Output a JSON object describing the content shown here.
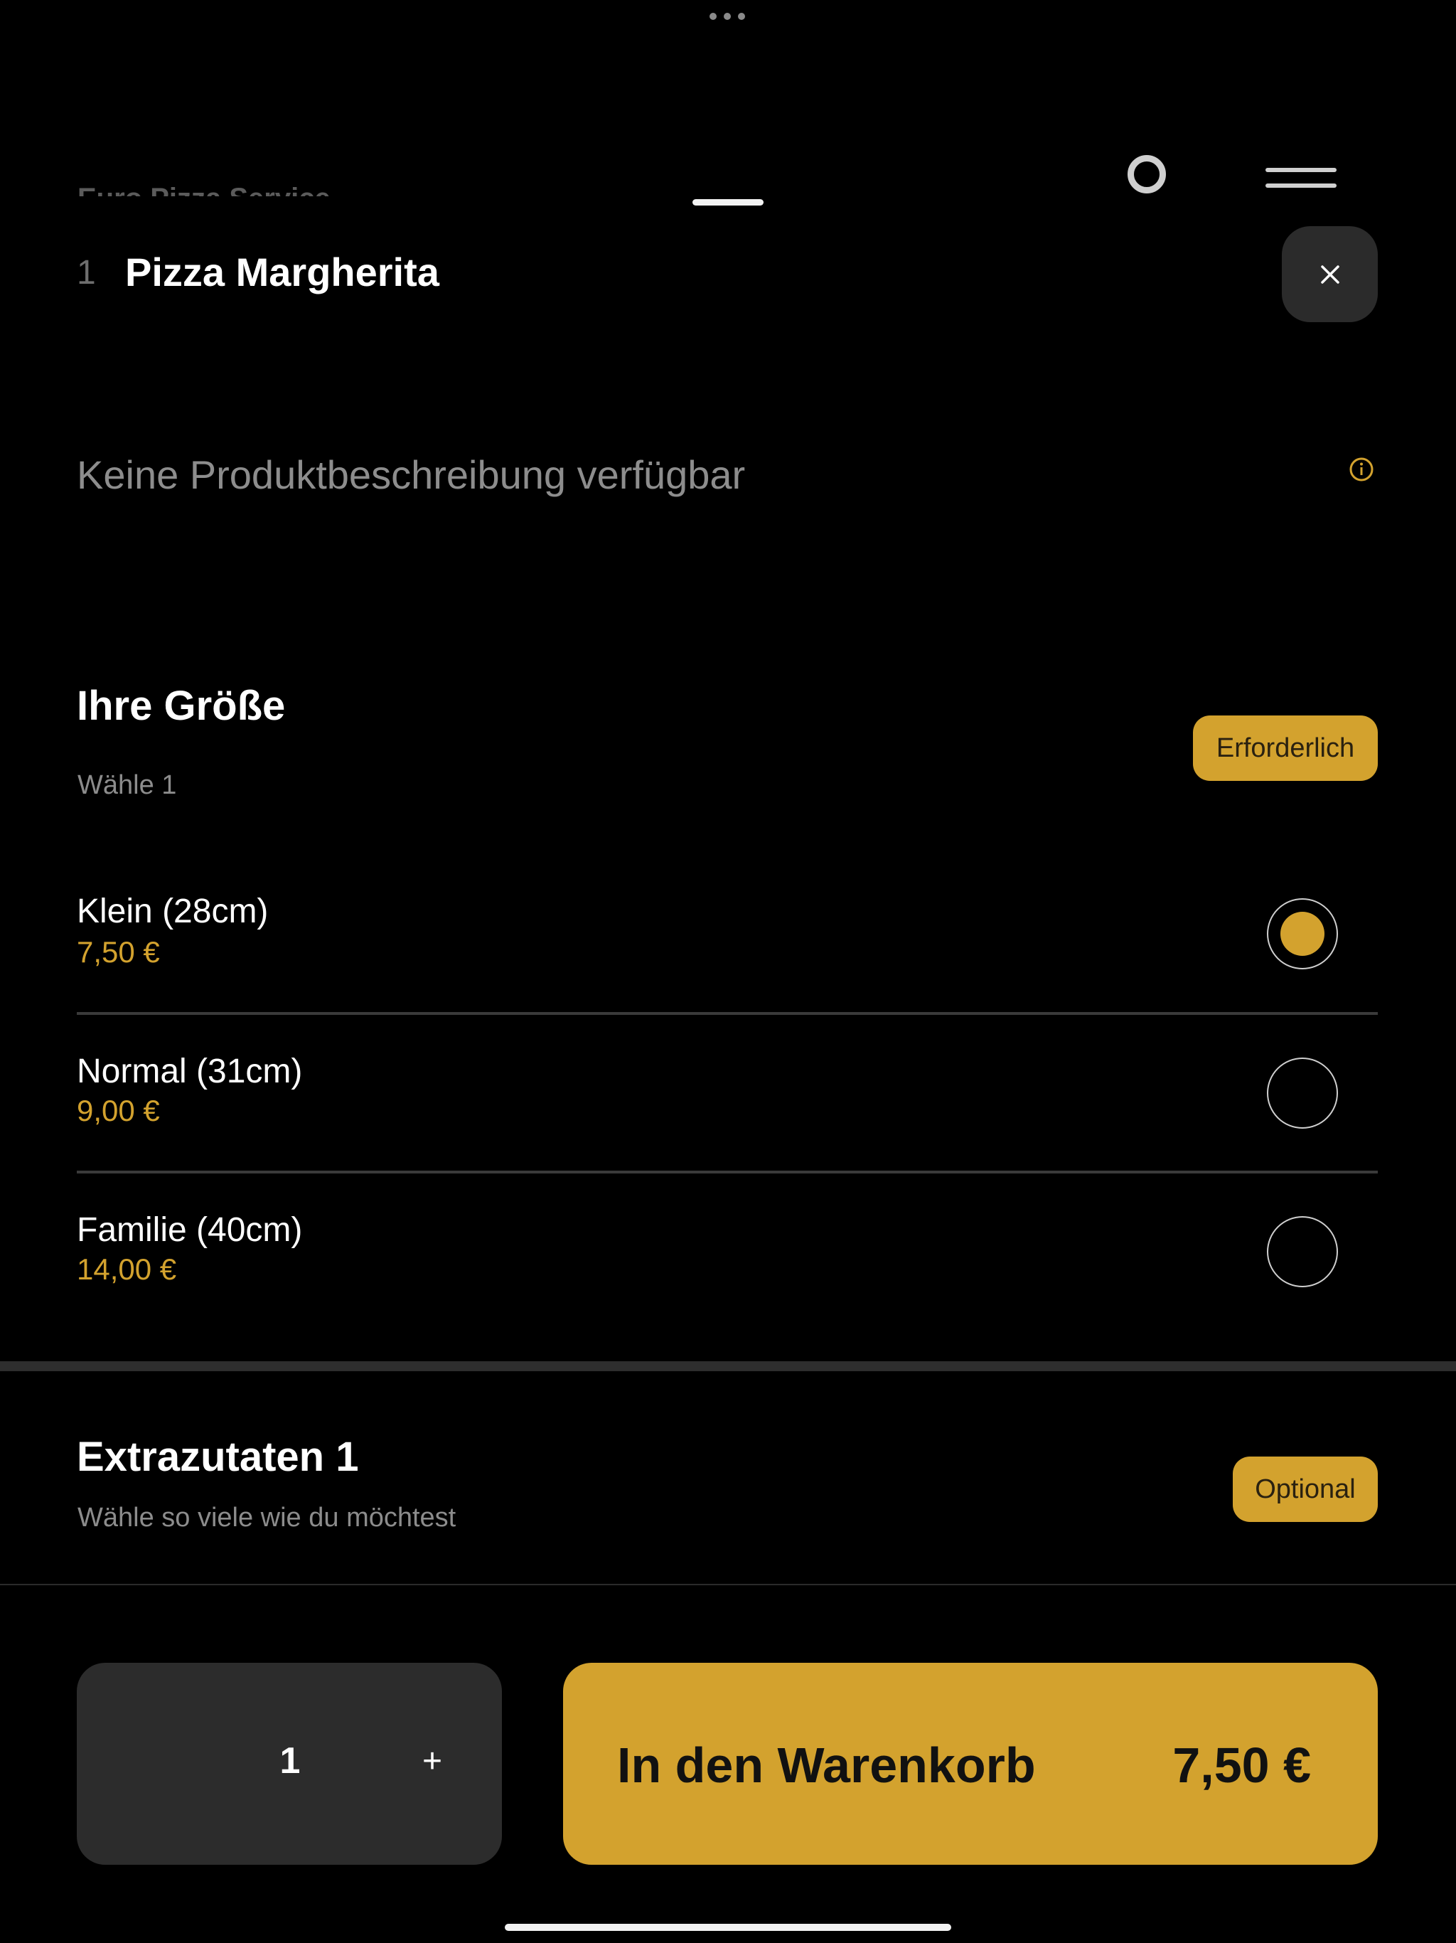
{
  "background": {
    "restaurant_name": "Euro Pizza Service"
  },
  "item": {
    "number": "1",
    "title": "Pizza Margherita",
    "description": "Keine Produktbeschreibung verfügbar"
  },
  "size_section": {
    "title": "Ihre Größe",
    "subtitle": "Wähle 1",
    "badge": "Erforderlich",
    "options": [
      {
        "label": "Klein (28cm)",
        "price": "7,50 €",
        "selected": true
      },
      {
        "label": "Normal (31cm)",
        "price": "9,00 €",
        "selected": false
      },
      {
        "label": "Familie (40cm)",
        "price": "14,00 €",
        "selected": false
      }
    ]
  },
  "extras_section": {
    "title": "Extrazutaten 1",
    "subtitle": "Wähle so viele wie du möchtest",
    "badge": "Optional"
  },
  "bottom_bar": {
    "quantity": "1",
    "plus_label": "+",
    "cart_label": "In den Warenkorb",
    "cart_price": "7,50 €"
  },
  "colors": {
    "accent": "#d3a22e",
    "background": "#000000",
    "surface": "#2c2c2c"
  }
}
